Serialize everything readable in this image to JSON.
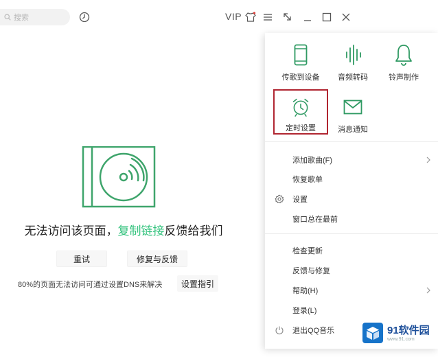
{
  "titlebar": {
    "search_placeholder": "搜索",
    "vip_label": "VIP"
  },
  "error_page": {
    "title_prefix": "无法访问该页面，",
    "title_link": "复制链接",
    "title_suffix": "反馈给我们",
    "retry_label": "重试",
    "repair_label": "修复与反馈",
    "dns_tip": "80%的页面无法访问可通过设置DNS来解决",
    "guide_label": "设置指引"
  },
  "menu": {
    "grid": [
      {
        "label": "传歌到设备",
        "icon": "phone-icon"
      },
      {
        "label": "音频转码",
        "icon": "waveform-icon"
      },
      {
        "label": "铃声制作",
        "icon": "bell-icon"
      },
      {
        "label": "定时设置",
        "icon": "alarm-clock-icon",
        "selected": true
      },
      {
        "label": "消息通知",
        "icon": "mail-icon"
      }
    ],
    "items": [
      {
        "label": "添加歌曲(F)",
        "has_submenu": true
      },
      {
        "label": "恢复歌单"
      },
      {
        "label": "设置",
        "icon": "gear-icon"
      },
      {
        "label": "窗口总在最前"
      },
      {
        "label": "检查更新"
      },
      {
        "label": "反馈与修复"
      },
      {
        "label": "帮助(H)",
        "has_submenu": true
      },
      {
        "label": "登录(L)"
      },
      {
        "label": "退出QQ音乐",
        "icon": "power-icon"
      }
    ]
  },
  "watermark": {
    "name": "91软件园",
    "url": "www.91.com"
  },
  "colors": {
    "accent_green": "#31c27c",
    "selection_border": "#b02530"
  }
}
